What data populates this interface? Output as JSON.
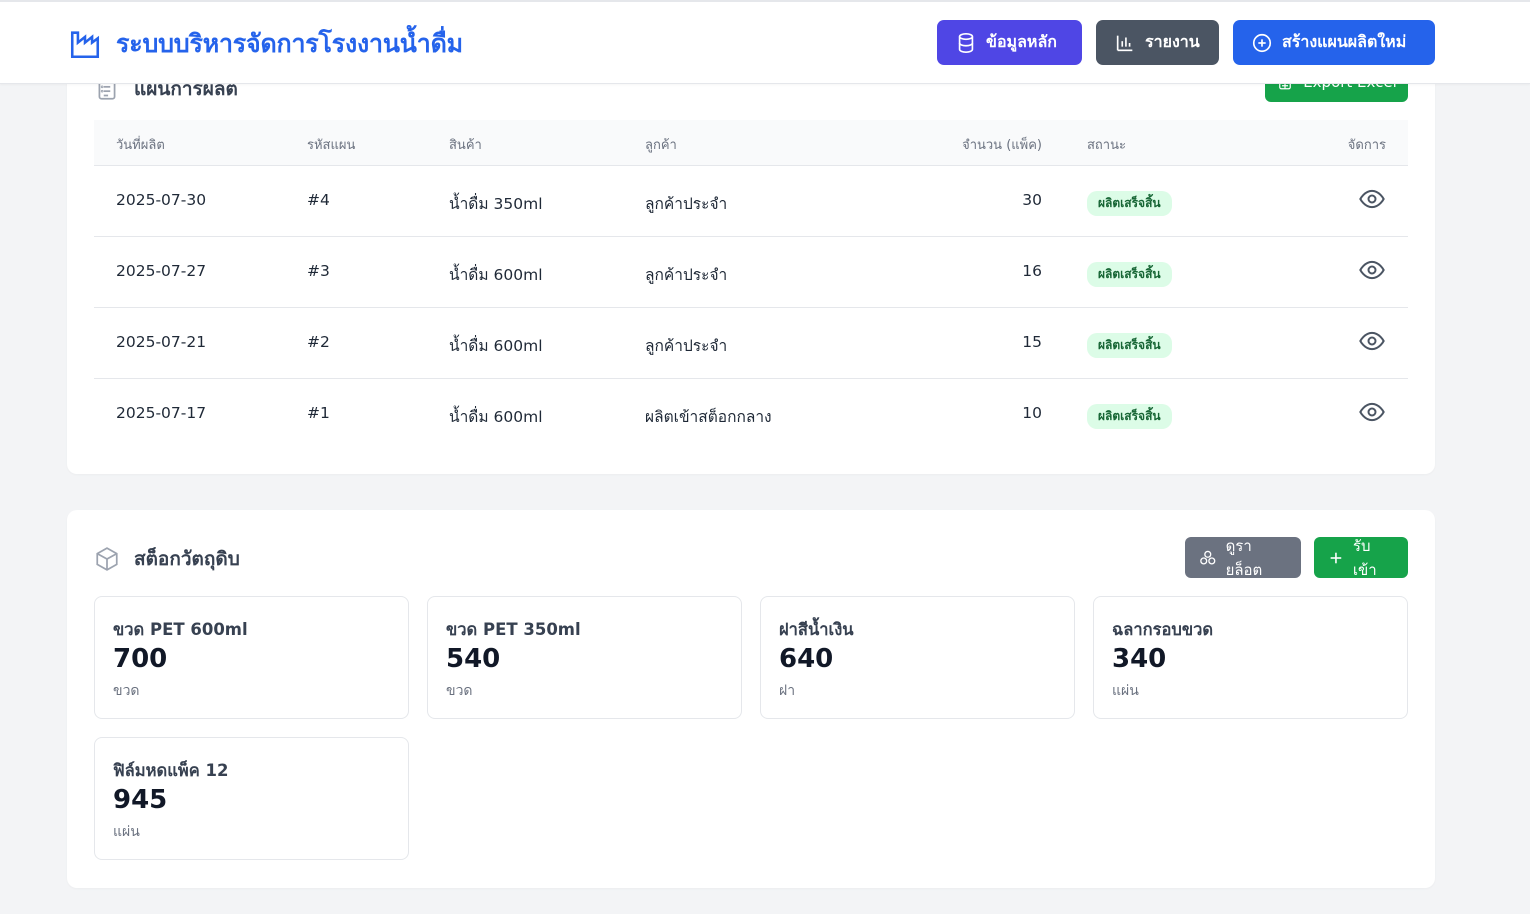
{
  "app": {
    "title": "ระบบบริหารจัดการโรงงานน้ำดื่ม",
    "accent": "#2563eb"
  },
  "header": {
    "buttons": [
      {
        "label": "ข้อมูลหลัก",
        "icon": "database-icon",
        "color": "#4f46e5"
      },
      {
        "label": "รายงาน",
        "icon": "bar-chart-icon",
        "color": "#4b5563"
      },
      {
        "label": "สร้างแผนผลิตใหม่",
        "icon": "plus-circle-icon",
        "color": "#2563eb"
      }
    ]
  },
  "plan": {
    "title": "แผนการผลิต",
    "export_label": "Export Excel",
    "columns": [
      "วันที่ผลิต",
      "รหัสแผน",
      "สินค้า",
      "ลูกค้า",
      "จำนวน (แพ็ค)",
      "สถานะ",
      "จัดการ"
    ],
    "rows": [
      {
        "date": "2025-07-30",
        "code": "#4",
        "product": "น้ำดื่ม 350ml",
        "customer": "ลูกค้าประจำ",
        "qty": "30",
        "status": "ผลิตเสร็จสิ้น"
      },
      {
        "date": "2025-07-27",
        "code": "#3",
        "product": "น้ำดื่ม 600ml",
        "customer": "ลูกค้าประจำ",
        "qty": "16",
        "status": "ผลิตเสร็จสิ้น"
      },
      {
        "date": "2025-07-21",
        "code": "#2",
        "product": "น้ำดื่ม 600ml",
        "customer": "ลูกค้าประจำ",
        "qty": "15",
        "status": "ผลิตเสร็จสิ้น"
      },
      {
        "date": "2025-07-17",
        "code": "#1",
        "product": "น้ำดื่ม 600ml",
        "customer": "ผลิตเข้าสต็อกกลาง",
        "qty": "10",
        "status": "ผลิตเสร็จสิ้น"
      }
    ],
    "status_color": "#166534"
  },
  "stock": {
    "title": "สต็อกวัตถุดิบ",
    "lot_label": "ดูรายล็อต",
    "receive_label": "รับเข้า",
    "items": [
      {
        "name": "ขวด PET 600ml",
        "qty": "700",
        "unit": "ขวด"
      },
      {
        "name": "ขวด PET 350ml",
        "qty": "540",
        "unit": "ขวด"
      },
      {
        "name": "ฝาสีน้ำเงิน",
        "qty": "640",
        "unit": "ฝา"
      },
      {
        "name": "ฉลากรอบขวด",
        "qty": "340",
        "unit": "แผ่น"
      },
      {
        "name": "ฟิล์มหดแพ็ค 12",
        "qty": "945",
        "unit": "แผ่น"
      }
    ]
  }
}
